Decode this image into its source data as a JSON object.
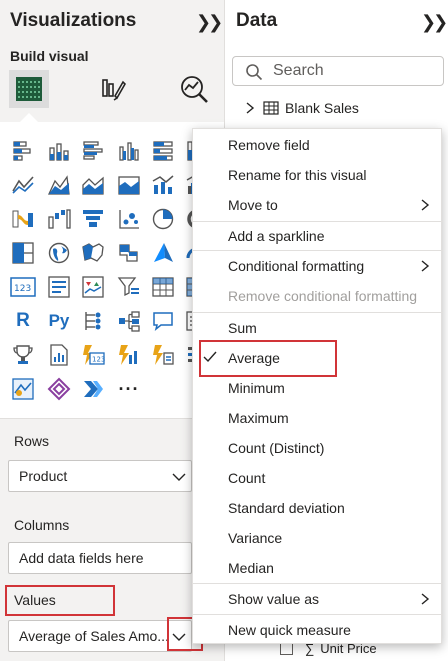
{
  "visualizations": {
    "title": "Visualizations",
    "build_visual_label": "Build visual",
    "more_label": "···",
    "wells": {
      "rows_label": "Rows",
      "rows_value": "Product",
      "columns_label": "Columns",
      "columns_placeholder": "Add data fields here",
      "values_label": "Values",
      "values_value": "Average of Sales Amo..."
    }
  },
  "data": {
    "title": "Data",
    "search_placeholder": "Search",
    "table_name": "Blank Sales",
    "field_unit_price": "Unit Price",
    "sigma_symbol": "∑"
  },
  "context_menu": {
    "items": [
      {
        "label": "Remove field"
      },
      {
        "label": "Rename for this visual"
      },
      {
        "label": "Move to",
        "submenu": true
      },
      {
        "label": "Add a sparkline"
      },
      {
        "label": "Conditional formatting",
        "submenu": true
      },
      {
        "label": "Remove conditional formatting",
        "disabled": true
      },
      {
        "label": "Sum"
      },
      {
        "label": "Average",
        "checked": true
      },
      {
        "label": "Minimum"
      },
      {
        "label": "Maximum"
      },
      {
        "label": "Count (Distinct)"
      },
      {
        "label": "Count"
      },
      {
        "label": "Standard deviation"
      },
      {
        "label": "Variance"
      },
      {
        "label": "Median"
      },
      {
        "label": "Show value as",
        "submenu": true
      },
      {
        "label": "New quick measure"
      }
    ]
  },
  "colors": {
    "accent_blue": "#1f6dbd",
    "highlight_red": "#d13438",
    "teal": "#118dff",
    "orange": "#e8a317",
    "dark_green": "#1e5b3a"
  }
}
